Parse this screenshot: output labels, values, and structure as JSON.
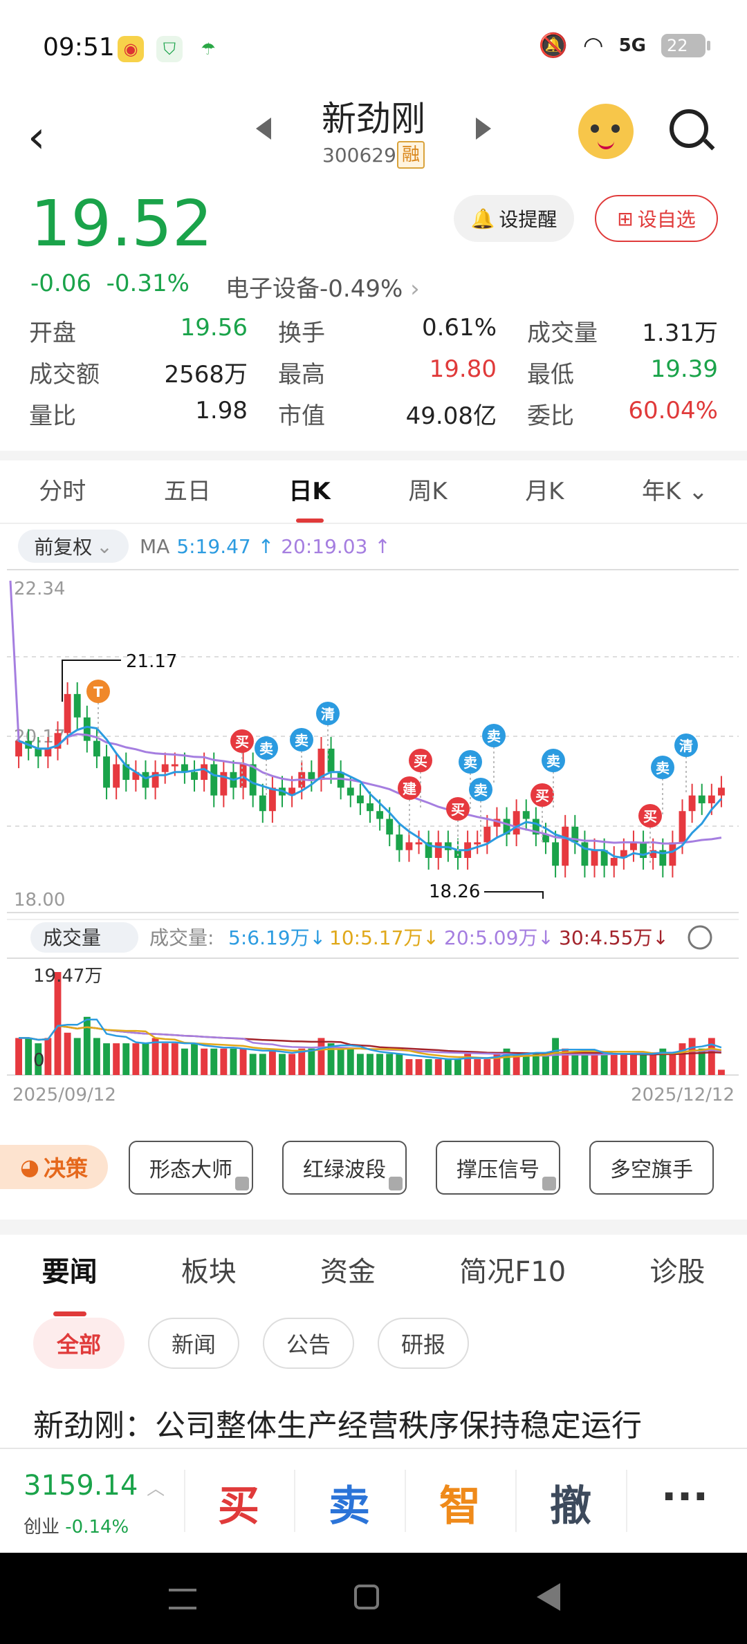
{
  "status": {
    "time": "09:51",
    "battery": "22",
    "net": "5G"
  },
  "header": {
    "name": "新劲刚",
    "code": "300629",
    "badge": "融"
  },
  "quote": {
    "price": "19.52",
    "change": "-0.06",
    "pct": "-0.31%",
    "sector": "电子设备-0.49%",
    "alert_label": "设提醒",
    "fav_label": "设自选",
    "rows": [
      [
        {
          "label": "开盘",
          "value": "19.56",
          "color": "#1aa34a"
        },
        {
          "label": "换手",
          "value": "0.61%",
          "color": "#222"
        },
        {
          "label": "成交量",
          "value": "1.31万",
          "color": "#222"
        }
      ],
      [
        {
          "label": "成交额",
          "value": "2568万",
          "color": "#222"
        },
        {
          "label": "最高",
          "value": "19.80",
          "color": "#e03a3a"
        },
        {
          "label": "最低",
          "value": "19.39",
          "color": "#1aa34a"
        }
      ],
      [
        {
          "label": "量比",
          "value": "1.98",
          "color": "#222"
        },
        {
          "label": "市值",
          "value": "49.08亿",
          "color": "#222"
        },
        {
          "label": "委比",
          "value": "60.04%",
          "color": "#e03a3a"
        }
      ]
    ]
  },
  "tabs": [
    "分时",
    "五日",
    "日K",
    "周K",
    "月K",
    "年K"
  ],
  "active_tab": 2,
  "fq_label": "前复权",
  "ma": {
    "label": "MA",
    "ma5": "5:19.47",
    "ma20": "20:19.03"
  },
  "chart_data": {
    "type": "candlestick",
    "price_axis": {
      "max": "22.34",
      "mid": "20.17",
      "min": "18.00"
    },
    "annotations": {
      "high": "21.17",
      "low": "18.26"
    },
    "start_date": "2025/09/12",
    "end_date": "2025/12/12",
    "volume_label": "成交量",
    "volume_max": "19.47万",
    "volume_zero": "0",
    "vol_legend_prefix": "成交量:",
    "vol_legend": [
      "5:6.19万",
      "10:5.17万",
      "20:5.09万",
      "30:4.55万"
    ],
    "signals": {
      "buy": "买",
      "sell": "卖",
      "clear": "清",
      "build": "建",
      "t": "T"
    }
  },
  "strategy": {
    "juece": "决策",
    "buttons": [
      "形态大师",
      "红绿波段",
      "撑压信号",
      "多空旗手"
    ]
  },
  "news": {
    "tabs": [
      "要闻",
      "板块",
      "资金",
      "简况F10",
      "诊股"
    ],
    "chips": [
      "全部",
      "新闻",
      "公告",
      "研报"
    ],
    "headline": "新劲刚：公司整体生产经营秩序保持稳定运行"
  },
  "bottom": {
    "index_value": "3159.14",
    "index_name": "创业",
    "index_pct": "-0.14%",
    "buy": "买",
    "sell": "卖",
    "smart": "智",
    "cancel": "撤",
    "more": "···"
  }
}
